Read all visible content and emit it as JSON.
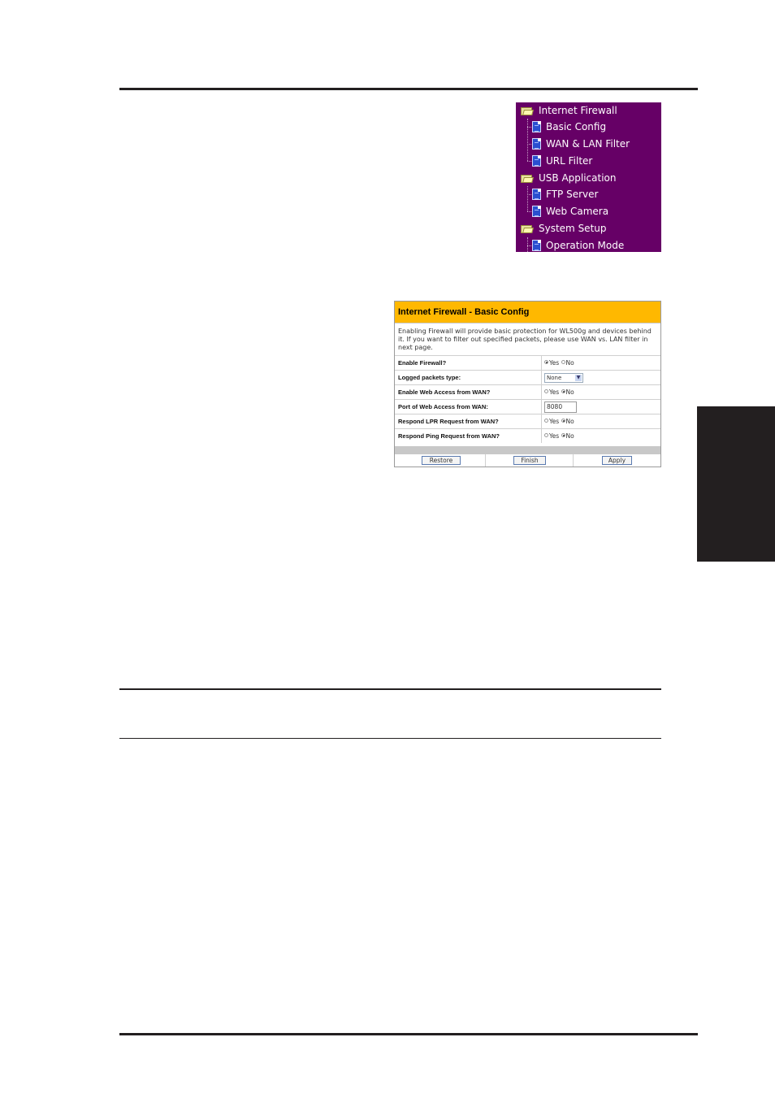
{
  "menu": {
    "items": [
      {
        "type": "folder",
        "label": "Internet Firewall",
        "icon": "folder-icon"
      },
      {
        "type": "page",
        "label": "Basic Config",
        "icon": "page-icon"
      },
      {
        "type": "page",
        "label": "WAN & LAN Filter",
        "icon": "page-icon"
      },
      {
        "type": "page",
        "label": "URL Filter",
        "icon": "page-icon"
      },
      {
        "type": "folder",
        "label": "USB Application",
        "icon": "folder-icon"
      },
      {
        "type": "page",
        "label": "FTP Server",
        "icon": "page-icon"
      },
      {
        "type": "page",
        "label": "Web Camera",
        "icon": "page-icon"
      },
      {
        "type": "folder",
        "label": "System Setup",
        "icon": "folder-icon"
      },
      {
        "type": "page",
        "label": "Operation Mode",
        "icon": "page-icon"
      }
    ],
    "background": "#660066"
  },
  "panel": {
    "title": "Internet Firewall - Basic Config",
    "title_bg": "#ffb800",
    "description": "Enabling Firewall will provide basic protection for WL500g and devices behind it. If you want to filter out specified packets, please use WAN vs. LAN filter in next page.",
    "fields": [
      {
        "label": "Enable Firewall?",
        "type": "radio",
        "options": [
          "Yes",
          "No"
        ],
        "selected": "Yes"
      },
      {
        "label": "Logged packets type:",
        "type": "select",
        "value": "None"
      },
      {
        "label": "Enable Web Access from WAN?",
        "type": "radio",
        "options": [
          "Yes",
          "No"
        ],
        "selected": "No"
      },
      {
        "label": "Port of Web Access from WAN:",
        "type": "text",
        "value": "8080"
      },
      {
        "label": "Respond LPR Request from WAN?",
        "type": "radio",
        "options": [
          "Yes",
          "No"
        ],
        "selected": "No"
      },
      {
        "label": "Respond Ping Request from WAN?",
        "type": "radio",
        "options": [
          "Yes",
          "No"
        ],
        "selected": "No"
      }
    ],
    "buttons": {
      "restore": "Restore",
      "finish": "Finish",
      "apply": "Apply"
    }
  }
}
